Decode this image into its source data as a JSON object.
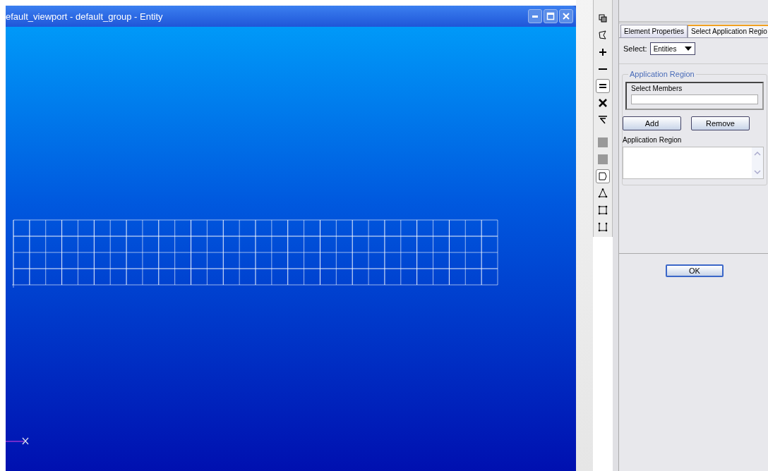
{
  "viewport": {
    "title": "efault_viewport - default_group - Entity"
  },
  "tools": [
    {
      "selected": false
    },
    {
      "selected": false
    },
    {
      "selected": false
    },
    {
      "selected": false
    },
    {
      "selected": true
    },
    {
      "selected": false
    },
    {
      "selected": false
    },
    {
      "selected": false
    },
    {
      "selected": false
    },
    {
      "selected": true
    },
    {
      "selected": false
    },
    {
      "selected": false
    },
    {
      "selected": false
    }
  ],
  "tabs": [
    {
      "label": "Element Properties",
      "selected": false
    },
    {
      "label": "Select Application Regio",
      "selected": true
    }
  ],
  "select": {
    "label": "Select:",
    "value": "Entities"
  },
  "group": {
    "title": "Application Region",
    "members_label": "Select Members",
    "buttons": [
      "Add",
      "Remove"
    ],
    "list_label": "Application Region"
  },
  "ok": "OK"
}
